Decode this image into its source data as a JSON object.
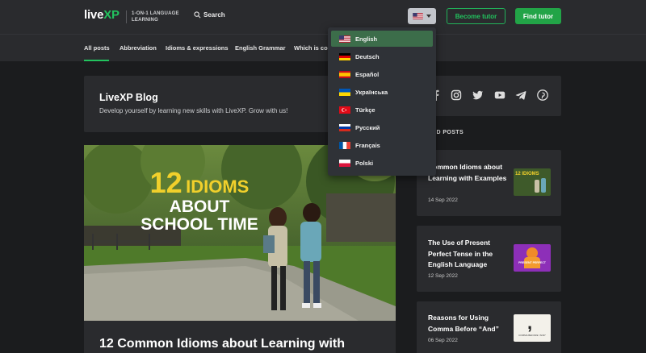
{
  "header": {
    "logo_main": "live",
    "logo_accent": "XP",
    "tagline": "1-ON-1 LANGUAGE LEARNING",
    "search_label": "Search",
    "become_tutor": "Become tutor",
    "find_tutor": "Find tutor",
    "accent_color": "#22c35e"
  },
  "nav": {
    "items": [
      {
        "label": "All posts"
      },
      {
        "label": "Abbreviation"
      },
      {
        "label": "Idioms & expressions"
      },
      {
        "label": "English Grammar"
      },
      {
        "label": "Which is cor"
      }
    ]
  },
  "blog": {
    "title": "LiveXP Blog",
    "subtitle": "Develop yourself by learning new skills with LiveXP. Grow with us!"
  },
  "hero": {
    "number": "12",
    "word1": "IDIOMS",
    "line2": "ABOUT",
    "line3": "SCHOOL TIME",
    "post_title": "12 Common Idioms about Learning with"
  },
  "featured": {
    "label": "RED POSTS",
    "posts": [
      {
        "title": "Common Idioms about Learning with Examples",
        "date": "14 Sep 2022",
        "thumb_text": "12 IDIOMS"
      },
      {
        "title": "The Use of Present Perfect Tense in the English Language",
        "date": "12 Sep 2022",
        "thumb_text": "PRESENT PERFECT"
      },
      {
        "title": "Reasons for Using Comma Before “And”",
        "date": "06 Sep 2022",
        "thumb_text": "COMMA BEFORE \"AND\""
      }
    ]
  },
  "languages": {
    "selected": "English",
    "options": [
      {
        "label": "English",
        "flag": "us-flag"
      },
      {
        "label": "Deutsch",
        "flag": "de-flag"
      },
      {
        "label": "Español",
        "flag": "es-flag"
      },
      {
        "label": "Українська",
        "flag": "ua-flag"
      },
      {
        "label": "Türkçe",
        "flag": "tr-flag"
      },
      {
        "label": "Русский",
        "flag": "ru-flag"
      },
      {
        "label": "Français",
        "flag": "fr-flag"
      },
      {
        "label": "Polski",
        "flag": "pl-flag"
      }
    ]
  }
}
